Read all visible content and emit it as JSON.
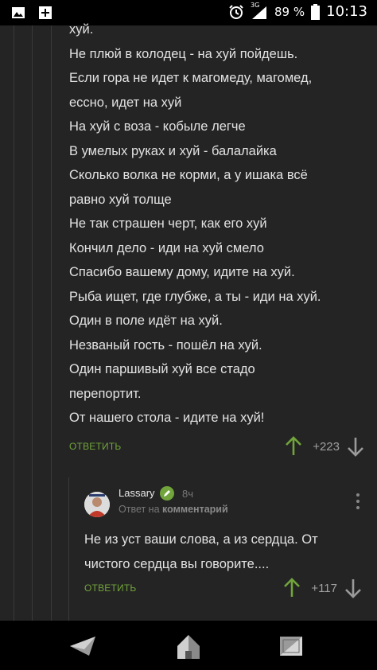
{
  "status_bar": {
    "network": "3G",
    "battery_percent": "89 %",
    "time": "10:13",
    "left_icons": [
      "image-notification-icon",
      "add-notification-icon"
    ]
  },
  "comment": {
    "lines": [
      "хуй.",
      "Не плюй в колодец - на хуй пойдешь.",
      "Если гора не идет к магомеду, магомед,",
      "ессно, идет на хуй",
      "На хуй с воза - кобыле легче",
      "В умелых руках и хуй - балалайка",
      "Сколько волка не корми, а у ишака всё",
      "равно хуй толще",
      "Не так страшен черт, как его хуй",
      "Кончил дело - иди на хуй смело",
      "Спасибо вашему дому, идите на хуй.",
      "Рыба ищет, где глубже, а ты - иди на хуй.",
      "Один в поле идёт на хуй.",
      "Незваный гость - пошёл на хуй.",
      "Один паршивый хуй все стадо",
      "перепортит.",
      "От нашего стола - идите на хуй!"
    ],
    "reply_label": "ОТВЕТИТЬ",
    "rating": "+223"
  },
  "reply": {
    "username": "Lassary",
    "time": "8ч",
    "sub_prefix": "Ответ на",
    "sub_link": "комментарий",
    "lines": [
      "Не из уст ваши слова, а из сердца. От",
      "чистого сердца вы говорите...."
    ],
    "reply_label": "ОТВЕТИТЬ",
    "rating": "+117"
  },
  "colors": {
    "background": "#242424",
    "accent_green": "#71a43b",
    "text": "#e2e2e2",
    "muted": "#777777"
  }
}
